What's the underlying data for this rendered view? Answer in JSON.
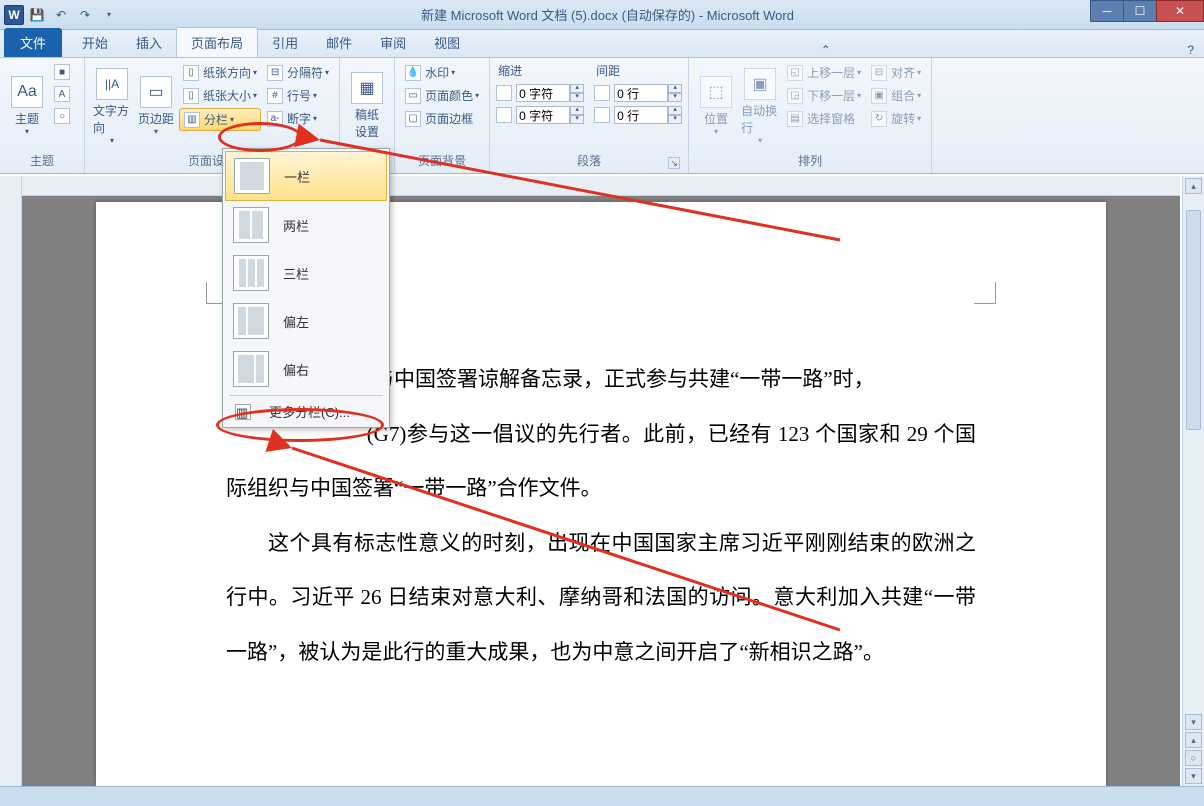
{
  "title": "新建 Microsoft Word 文档 (5).docx (自动保存的) - Microsoft Word",
  "app_icon": "W",
  "tabs": {
    "file": "文件",
    "items": [
      "开始",
      "插入",
      "页面布局",
      "引用",
      "邮件",
      "审阅",
      "视图"
    ],
    "active": "页面布局"
  },
  "groups": {
    "themes": {
      "label": "主题",
      "btn": "主题"
    },
    "pagesetup": {
      "label": "页面设置",
      "textdir": "文字方向",
      "margins": "页边距",
      "orientation": "纸张方向",
      "size": "纸张大小",
      "columns": "分栏",
      "breaks": "分隔符",
      "linenum": "行号",
      "hyphen": "断字"
    },
    "manuscript": {
      "label": "稿纸",
      "btn": "稿纸\n设置"
    },
    "pagebg": {
      "label": "页面背景",
      "watermark": "水印",
      "pagecolor": "页面颜色",
      "border": "页面边框"
    },
    "paragraph": {
      "label": "段落",
      "indent": "缩进",
      "spacing": "间距",
      "left_val": "0 字符",
      "right_val": "0 字符",
      "before_val": "0 行",
      "after_val": "0 行"
    },
    "arrange": {
      "label": "排列",
      "position": "位置",
      "wrap": "自动换行",
      "forward": "上移一层",
      "backward": "下移一层",
      "pane": "选择窗格",
      "align": "对齐",
      "group": "组合",
      "rotate": "旋转"
    }
  },
  "columns_menu": {
    "one": "一栏",
    "two": "两栏",
    "three": "三栏",
    "left": "偏左",
    "right": "偏右",
    "more": "更多分栏(C)..."
  },
  "document": {
    "p1a": "与中国签署谅解备忘录，正式参与共建“一带一路”时，",
    "p1b": "(G7)参与这一倡议的先行者。此前，已经有 123 个国家和 29 个国际组织与中国签署“一带一路”合作文件。",
    "p2": "这个具有标志性意义的时刻，出现在中国国家主席习近平刚刚结束的欧洲之行中。习近平 26 日结束对意大利、摩纳哥和法国的访问。意大利加入共建“一带一路”，被认为是此行的重大成果，也为中意之间开启了“新相识之路”。"
  }
}
